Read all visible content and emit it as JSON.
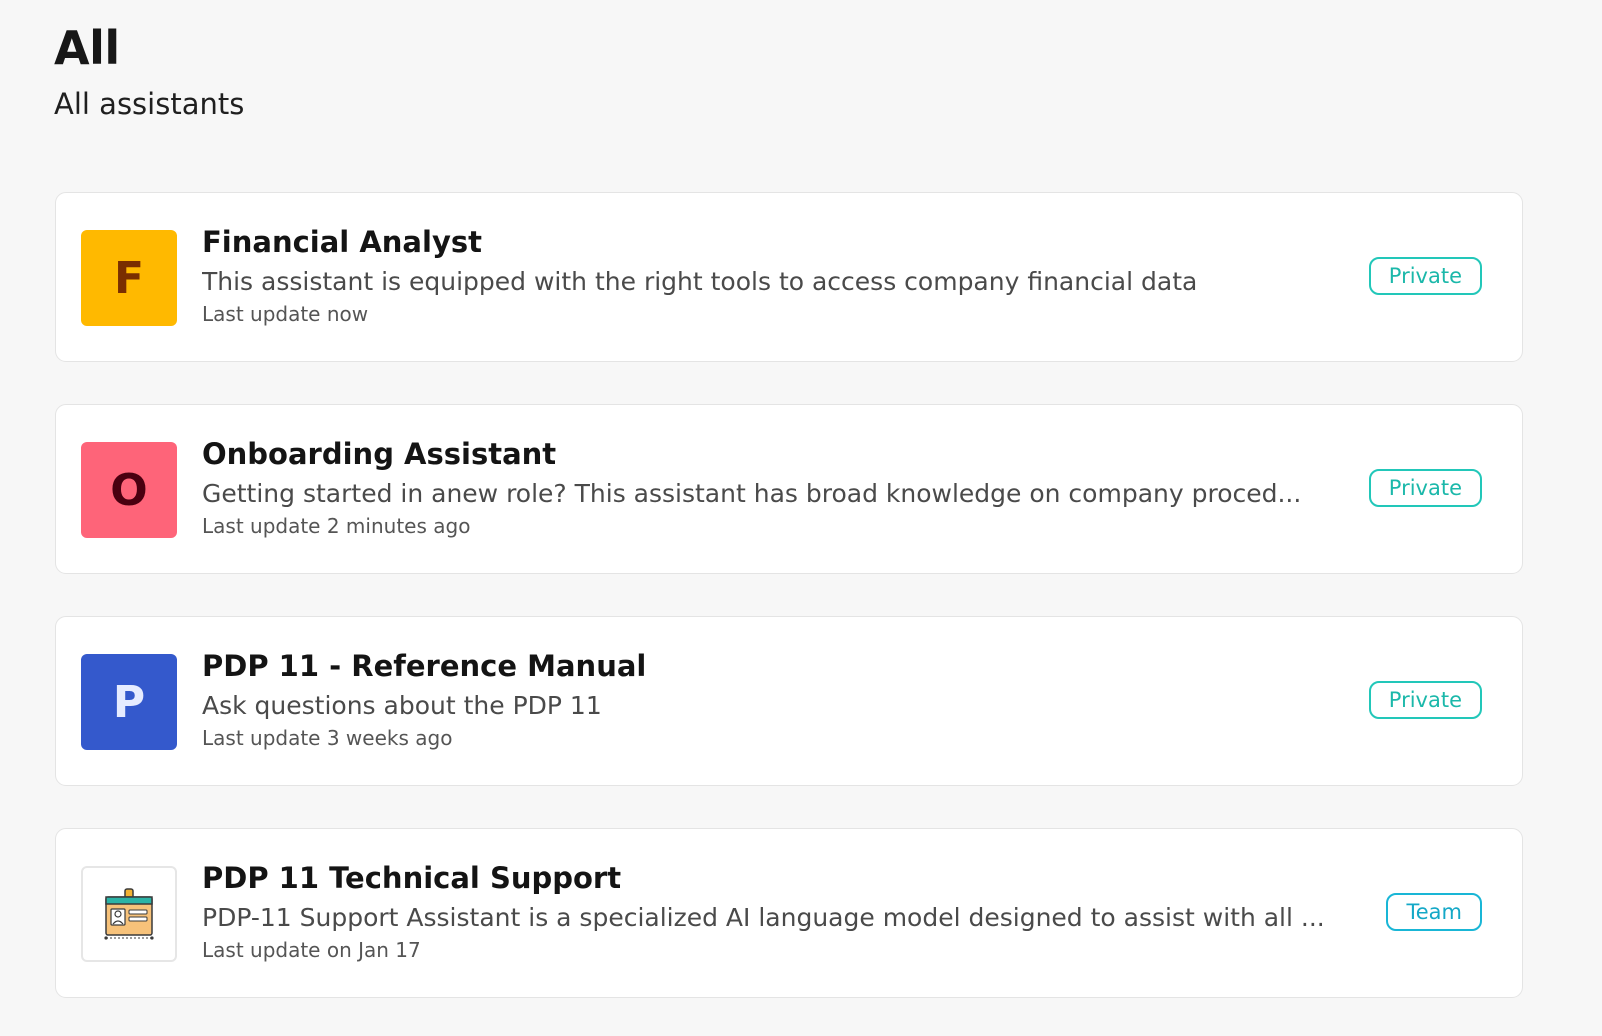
{
  "header": {
    "title": "All",
    "subtitle": "All assistants"
  },
  "assistants": [
    {
      "initial": "F",
      "avatar_bg": "#FFB900",
      "avatar_fg": "#7A2E00",
      "name": "Financial Analyst",
      "description": "This assistant is equipped with the right tools to access company financial data",
      "updated": "Last update now",
      "visibility": "Private"
    },
    {
      "initial": "O",
      "avatar_bg": "#FE6479",
      "avatar_fg": "#4A0010",
      "name": "Onboarding Assistant",
      "description": "Getting started in anew role? This assistant has broad knowledge on company proced...",
      "updated": "Last update 2 minutes ago",
      "visibility": "Private"
    },
    {
      "initial": "P",
      "avatar_bg": "#3459CC",
      "avatar_fg": "#E6ECFF",
      "name": "PDP 11 - Reference Manual",
      "description": "Ask questions about the PDP 11",
      "updated": "Last update 3 weeks ago",
      "visibility": "Private"
    },
    {
      "avatar_icon": "id-badge-icon",
      "name": "PDP 11 Technical Support",
      "description": "PDP-11 Support Assistant is a specialized AI language model designed to assist with all ...",
      "updated": "Last update on Jan 17",
      "visibility": "Team"
    }
  ],
  "colors": {
    "badge_private": "#22C7B9",
    "badge_team": "#19B6D6",
    "background": "#F7F7F7"
  }
}
